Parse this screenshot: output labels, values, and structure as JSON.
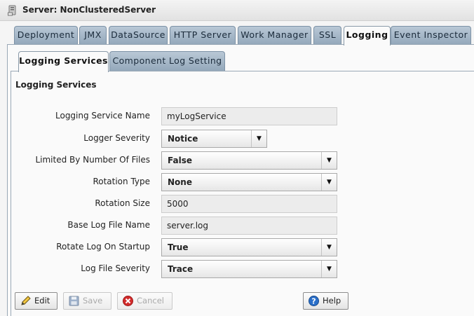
{
  "window": {
    "title": "Server: NonClusteredServer",
    "icon": "server-icon"
  },
  "outer_tabs": [
    {
      "label": "Deployment",
      "active": false
    },
    {
      "label": "JMX",
      "active": false
    },
    {
      "label": "DataSource",
      "active": false
    },
    {
      "label": "HTTP Server",
      "active": false
    },
    {
      "label": "Work Manager",
      "active": false
    },
    {
      "label": "SSL",
      "active": false
    },
    {
      "label": "Logging",
      "active": true
    },
    {
      "label": "Event Inspector",
      "active": false
    }
  ],
  "inner_tabs": [
    {
      "label": "Logging Services",
      "active": true
    },
    {
      "label": "Component Log Setting",
      "active": false
    }
  ],
  "section_title": "Logging Services",
  "form": {
    "logging_service_name": {
      "label": "Logging Service Name",
      "value": "myLogService"
    },
    "logger_severity": {
      "label": "Logger Severity",
      "value": "Notice"
    },
    "limited_by_number_of_files": {
      "label": "Limited By Number Of Files",
      "value": "False"
    },
    "rotation_type": {
      "label": "Rotation Type",
      "value": "None"
    },
    "rotation_size": {
      "label": "Rotation Size",
      "value": "5000"
    },
    "base_log_file_name": {
      "label": "Base Log File Name",
      "value": "server.log"
    },
    "rotate_log_on_startup": {
      "label": "Rotate Log On Startup",
      "value": "True"
    },
    "log_file_severity": {
      "label": "Log File Severity",
      "value": "Trace"
    }
  },
  "buttons": {
    "edit": {
      "label": "Edit",
      "icon": "pencil-icon",
      "enabled": true
    },
    "save": {
      "label": "Save",
      "icon": "floppy-disk-icon",
      "enabled": false
    },
    "cancel": {
      "label": "Cancel",
      "icon": "cancel-icon",
      "enabled": false
    },
    "help": {
      "label": "Help",
      "icon": "help-icon",
      "enabled": true
    }
  },
  "colors": {
    "tab_inactive": "#a7b8c8",
    "panel_border": "#9aa8b6",
    "help_blue": "#2a6fc9",
    "cancel_red": "#d22b2b"
  }
}
